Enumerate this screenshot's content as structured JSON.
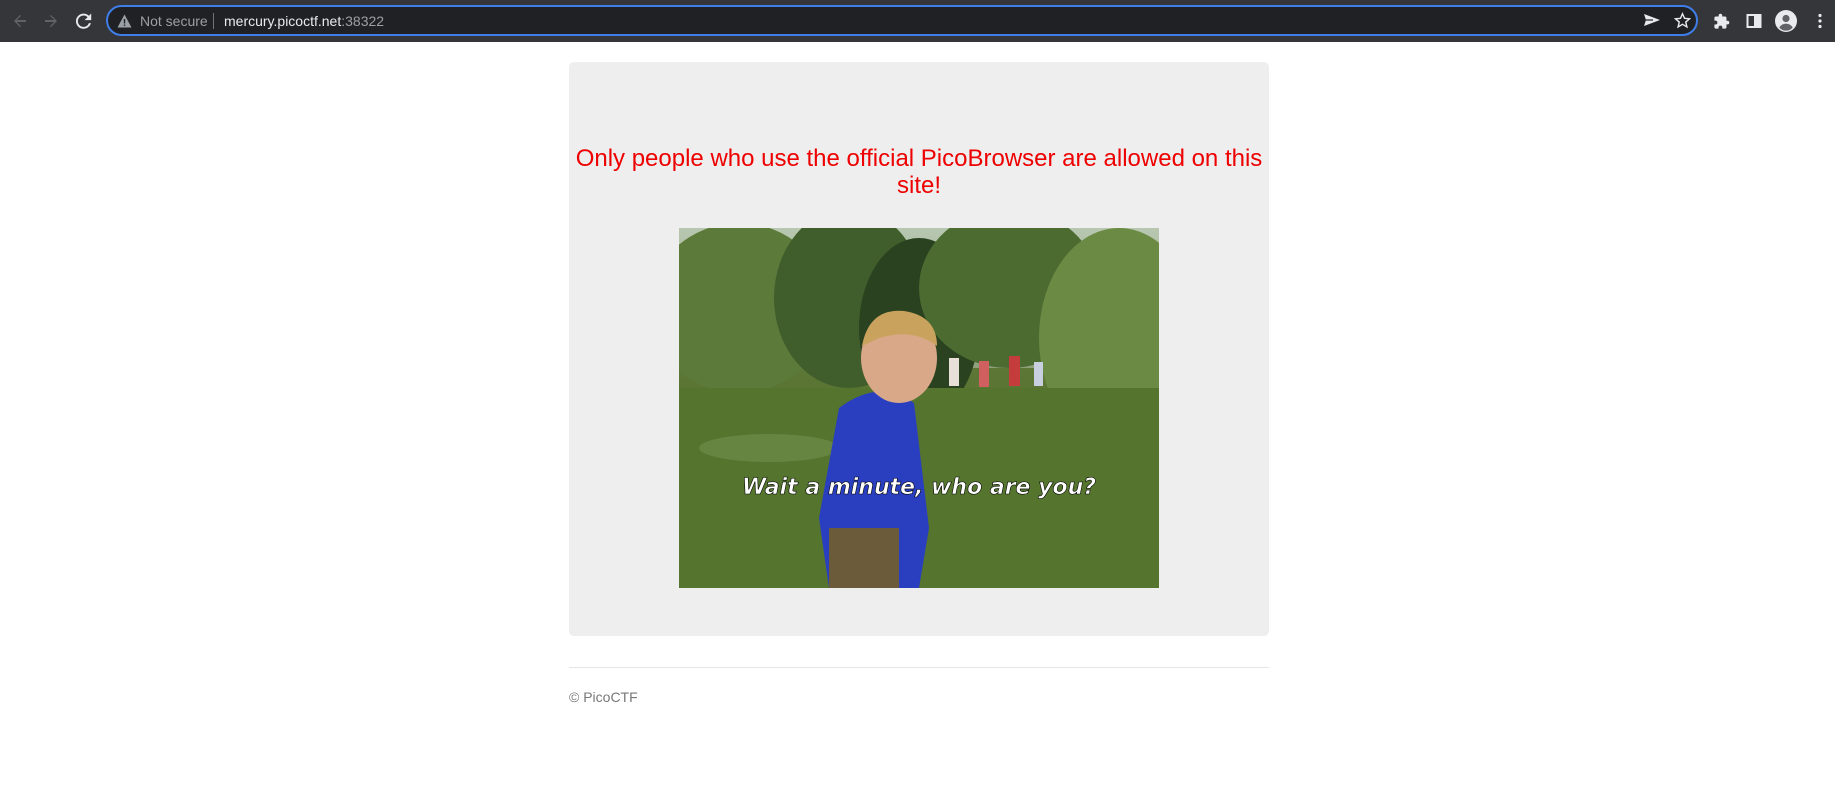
{
  "browser": {
    "security_label": "Not secure",
    "url_host": "mercury.picoctf.net",
    "url_port": ":38322",
    "icons": [
      "back-icon",
      "forward-icon",
      "reload-icon",
      "warning-icon",
      "send-tab-icon",
      "bookmark-star-icon",
      "extensions-icon",
      "side-panel-icon",
      "profile-icon",
      "menu-icon"
    ]
  },
  "page": {
    "heading": "Only people who use the official PicoBrowser are allowed on this site!",
    "image_caption": "Wait a minute, who are you?",
    "footer": "© PicoCTF",
    "heading_color": "#ee0000"
  }
}
